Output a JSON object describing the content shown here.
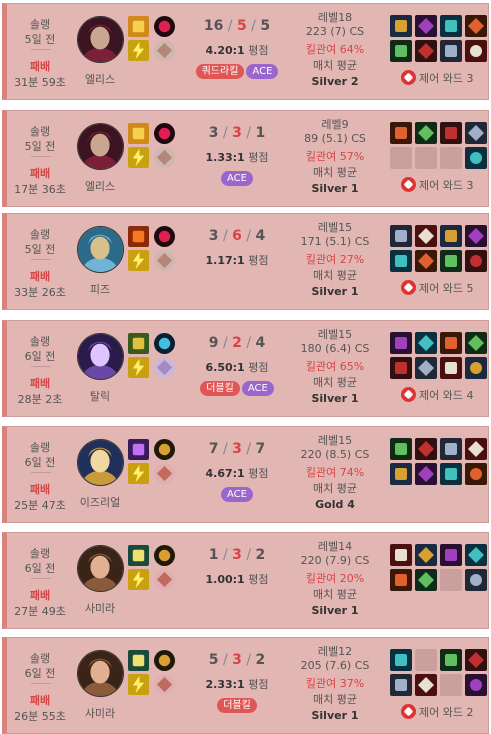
{
  "labels": {
    "kda_suffix": "평점",
    "avg_label": "매치 평균",
    "cs_suffix": "CS"
  },
  "colors": {
    "loss_bg": "#e2b6b3",
    "loss_accent": "#d9837d",
    "kill_participation": "#d64545",
    "badge_multikill": "#e05555",
    "badge_ace": "#9a66cc"
  },
  "games": [
    {
      "queue": "솔랭",
      "ago": "5일 전",
      "result": "패배",
      "duration": "31분 59초",
      "champion": "엘리스",
      "champion_icon": "elise-portrait",
      "spells": [
        "smite-icon",
        "flash-icon"
      ],
      "runes": [
        "electrocute-icon",
        "domination-icon"
      ],
      "kills": "16",
      "deaths": "5",
      "assists": "5",
      "ratio": "4.20:1",
      "badges": [
        {
          "label": "쿼드라킬",
          "type": "multi"
        },
        {
          "label": "ACE",
          "type": "ace"
        }
      ],
      "level": "레벨18",
      "cs": "223 (7) CS",
      "kill_participation": "킬관여 64%",
      "tier": "Silver 2",
      "items": [
        "item-1",
        "item-2",
        "item-3",
        "item-4",
        "item-5",
        "item-6",
        "item-7",
        "item-8"
      ],
      "control_wards": "제어 와드 3"
    },
    {
      "queue": "솔랭",
      "ago": "5일 전",
      "result": "패배",
      "duration": "17분 36초",
      "champion": "엘리스",
      "champion_icon": "elise-portrait",
      "spells": [
        "smite-icon",
        "flash-icon"
      ],
      "runes": [
        "electrocute-icon",
        "domination-icon"
      ],
      "kills": "3",
      "deaths": "3",
      "assists": "1",
      "ratio": "1.33:1",
      "badges": [
        {
          "label": "ACE",
          "type": "ace"
        }
      ],
      "level": "레벨9",
      "cs": "89 (5.1) CS",
      "kill_participation": "킬관여 57%",
      "tier": "Silver 1",
      "items": [
        "item-1",
        "item-2",
        "item-3",
        "item-4",
        "",
        "",
        "",
        "item-8"
      ],
      "control_wards": "제어 와드 3"
    },
    {
      "queue": "솔랭",
      "ago": "5일 전",
      "result": "패배",
      "duration": "33분 26초",
      "champion": "피즈",
      "champion_icon": "fizz-portrait",
      "spells": [
        "ignite-icon",
        "flash-icon"
      ],
      "runes": [
        "electrocute-icon",
        "domination-icon"
      ],
      "kills": "3",
      "deaths": "6",
      "assists": "4",
      "ratio": "1.17:1",
      "badges": [],
      "level": "레벨15",
      "cs": "171 (5.1) CS",
      "kill_participation": "킬관여 27%",
      "tier": "Silver 1",
      "items": [
        "item-1",
        "item-2",
        "item-3",
        "item-4",
        "item-5",
        "item-6",
        "item-7",
        "item-8"
      ],
      "control_wards": "제어 와드 5"
    },
    {
      "queue": "솔랭",
      "ago": "6일 전",
      "result": "패배",
      "duration": "28분 2초",
      "champion": "탈릭",
      "champion_icon": "taric-portrait",
      "spells": [
        "exhaust-icon",
        "flash-icon"
      ],
      "runes": [
        "aftershock-icon",
        "resolve-icon"
      ],
      "kills": "9",
      "deaths": "2",
      "assists": "4",
      "ratio": "6.50:1",
      "badges": [
        {
          "label": "더블킬",
          "type": "multi"
        },
        {
          "label": "ACE",
          "type": "ace"
        }
      ],
      "level": "레벨15",
      "cs": "180 (6.4) CS",
      "kill_participation": "킬관여 65%",
      "tier": "Silver 1",
      "items": [
        "item-1",
        "item-2",
        "item-3",
        "item-4",
        "item-5",
        "item-6",
        "item-7",
        "item-8"
      ],
      "control_wards": "제어 와드 4"
    },
    {
      "queue": "솔랭",
      "ago": "6일 전",
      "result": "패배",
      "duration": "25분 47초",
      "champion": "이즈리얼",
      "champion_icon": "ezreal-portrait",
      "spells": [
        "ghost-icon",
        "flash-icon"
      ],
      "runes": [
        "conqueror-icon",
        "precision-icon"
      ],
      "kills": "7",
      "deaths": "3",
      "assists": "7",
      "ratio": "4.67:1",
      "badges": [
        {
          "label": "ACE",
          "type": "ace"
        }
      ],
      "level": "레벨15",
      "cs": "220 (8.5) CS",
      "kill_participation": "킬관여 74%",
      "tier": "Gold 4",
      "items": [
        "item-1",
        "item-2",
        "item-3",
        "item-4",
        "item-5",
        "item-6",
        "item-7",
        "item-8"
      ],
      "control_wards": ""
    },
    {
      "queue": "솔랭",
      "ago": "6일 전",
      "result": "패배",
      "duration": "27분 49초",
      "champion": "사미라",
      "champion_icon": "samira-portrait",
      "spells": [
        "cleanse-icon",
        "flash-icon"
      ],
      "runes": [
        "conqueror-icon",
        "precision-icon"
      ],
      "kills": "1",
      "deaths": "3",
      "assists": "2",
      "ratio": "1.00:1",
      "badges": [],
      "level": "레벨14",
      "cs": "220 (7.9) CS",
      "kill_participation": "킬관여 20%",
      "tier": "Silver 1",
      "items": [
        "item-1",
        "item-2",
        "item-3",
        "item-4",
        "item-5",
        "item-6",
        "",
        "item-8"
      ],
      "control_wards": ""
    },
    {
      "queue": "솔랭",
      "ago": "6일 전",
      "result": "패배",
      "duration": "26분 55초",
      "champion": "사미라",
      "champion_icon": "samira-portrait",
      "spells": [
        "cleanse-icon",
        "flash-icon"
      ],
      "runes": [
        "conqueror-icon",
        "precision-icon"
      ],
      "kills": "5",
      "deaths": "3",
      "assists": "2",
      "ratio": "2.33:1",
      "badges": [
        {
          "label": "더블킬",
          "type": "multi"
        }
      ],
      "level": "레벨12",
      "cs": "205 (7.6) CS",
      "kill_participation": "킬관여 37%",
      "tier": "Silver 1",
      "items": [
        "item-1",
        "",
        "item-3",
        "item-4",
        "item-5",
        "item-6",
        "",
        "item-8"
      ],
      "control_wards": "제어 와드 2"
    }
  ]
}
